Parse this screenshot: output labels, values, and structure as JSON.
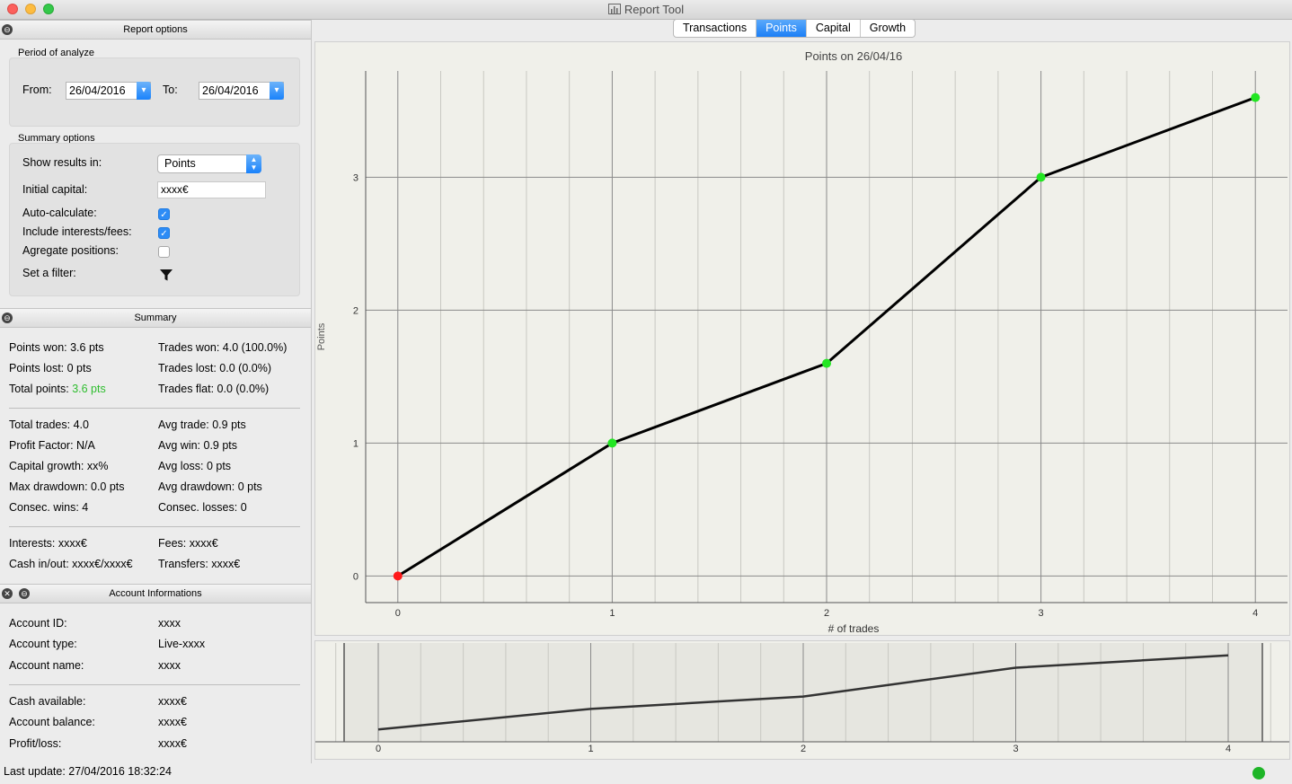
{
  "window": {
    "title": "Report Tool"
  },
  "tabs": [
    {
      "label": "Transactions",
      "active": false
    },
    {
      "label": "Points",
      "active": true
    },
    {
      "label": "Capital",
      "active": false
    },
    {
      "label": "Growth",
      "active": false
    }
  ],
  "report_options": {
    "header": "Report options",
    "period": {
      "title": "Period of analyze",
      "from_label": "From:",
      "from_value": "26/04/2016",
      "to_label": "To:",
      "to_value": "26/04/2016"
    },
    "summary_options": {
      "title": "Summary options",
      "show_results_label": "Show results in:",
      "show_results_value": "Points",
      "initial_capital_label": "Initial capital:",
      "initial_capital_value": "xxxx€",
      "auto_calculate_label": "Auto-calculate:",
      "auto_calculate_checked": true,
      "include_fees_label": "Include interests/fees:",
      "include_fees_checked": true,
      "aggregate_label": "Agregate positions:",
      "aggregate_checked": false,
      "filter_label": "Set a filter:"
    }
  },
  "summary": {
    "header": "Summary",
    "points_won": "Points won: 3.6 pts",
    "trades_won": "Trades won: 4.0 (100.0%)",
    "points_lost": "Points lost: 0 pts",
    "trades_lost": "Trades lost: 0.0 (0.0%)",
    "total_points_label": "Total points: ",
    "total_points_value": "3.6 pts",
    "total_points_color": "#2ebd2e",
    "trades_flat": "Trades flat: 0.0 (0.0%)",
    "total_trades": "Total trades: 4.0",
    "avg_trade": "Avg trade: 0.9 pts",
    "profit_factor": "Profit Factor: N/A",
    "avg_win": "Avg win: 0.9 pts",
    "capital_growth": "Capital growth: xx%",
    "avg_loss": "Avg loss: 0 pts",
    "max_drawdown": "Max drawdown: 0.0 pts",
    "avg_drawdown": "Avg drawdown: 0 pts",
    "consec_wins": "Consec. wins: 4",
    "consec_losses": "Consec. losses: 0",
    "interests": "Interests: xxxx€",
    "fees": "Fees: xxxx€",
    "cash_inout": "Cash in/out: xxxx€/xxxx€",
    "transfers": "Transfers: xxxx€"
  },
  "account": {
    "header": "Account Informations",
    "rows": [
      {
        "label": "Account ID:",
        "value": "xxxx"
      },
      {
        "label": "Account type:",
        "value": "Live-xxxx"
      },
      {
        "label": "Account name:",
        "value": "xxxx"
      },
      {
        "label": "Cash available:",
        "value": "xxxx€"
      },
      {
        "label": "Account balance:",
        "value": "xxxx€"
      },
      {
        "label": "Profit/loss:",
        "value": "xxxx€"
      }
    ]
  },
  "status": {
    "last_update": "Last update: 27/04/2016 18:32:24",
    "indicator_color": "#1eb527"
  },
  "chart_data": [
    {
      "type": "line",
      "title": "Points on 26/04/16",
      "xlabel": "# of trades",
      "ylabel": "Points",
      "x": [
        0,
        1,
        2,
        3,
        4
      ],
      "y": [
        0,
        1.0,
        1.6,
        3.0,
        3.6
      ],
      "point_colors": [
        "#ff1a1a",
        "#22e622",
        "#22e622",
        "#22e622",
        "#22e622"
      ],
      "line_color": "#000000",
      "xlim": [
        -0.15,
        4.15
      ],
      "ylim": [
        -0.2,
        3.8
      ],
      "xticks": [
        "0",
        "1",
        "2",
        "3",
        "4"
      ],
      "yticks": [
        "0",
        "1",
        "2",
        "3"
      ],
      "grid": true
    },
    {
      "type": "line",
      "title": "",
      "x": [
        0,
        1,
        2,
        3,
        4
      ],
      "y": [
        0,
        1.0,
        1.6,
        3.0,
        3.6
      ],
      "xticks": [
        "0",
        "1",
        "2",
        "3",
        "4"
      ],
      "line_color": "#333333",
      "grid": true
    }
  ]
}
